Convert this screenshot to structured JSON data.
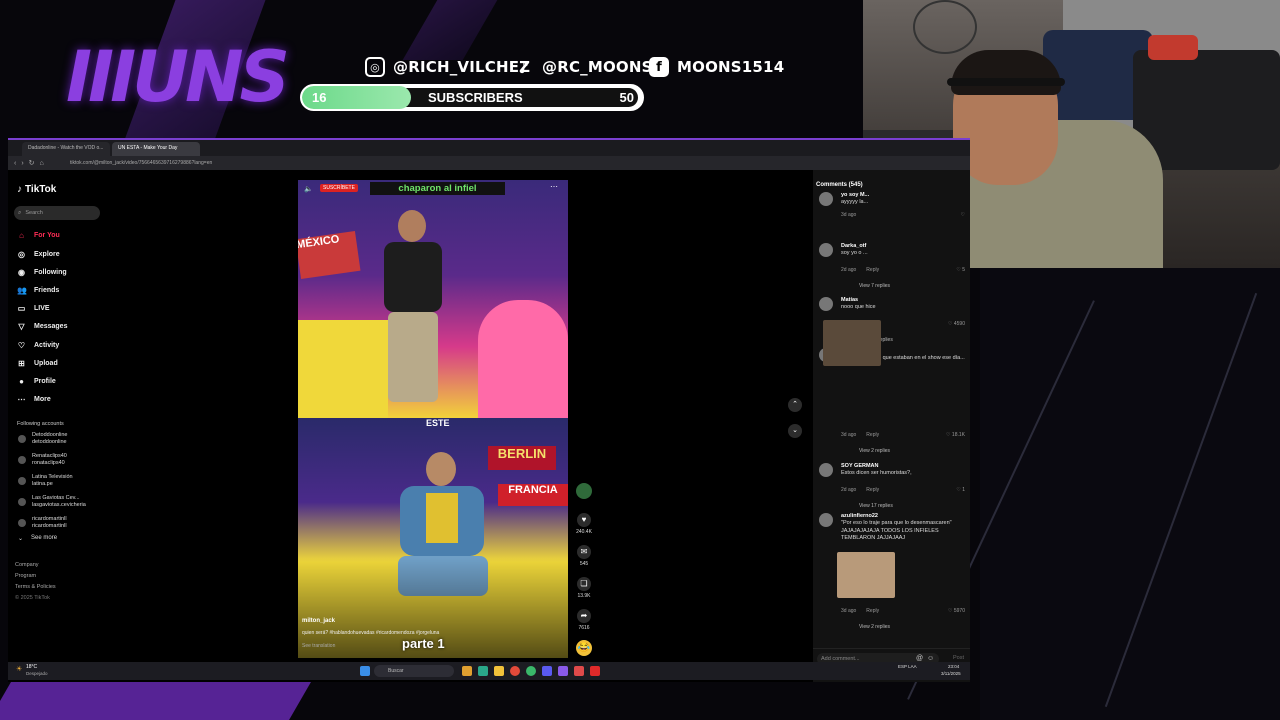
{
  "overlay": {
    "logo": "IIIUNS",
    "socials": [
      {
        "icon": "instagram-icon",
        "handle": "@RICH_VILCHEZ"
      },
      {
        "icon": "tiktok-icon",
        "handle": "@RC_MOONS"
      },
      {
        "icon": "facebook-icon",
        "handle": "MOONS1514"
      }
    ],
    "subscribers": {
      "current": "16",
      "label": "SUBSCRIBERS",
      "goal": "50",
      "progress": 0.32
    }
  },
  "browser": {
    "tabs": [
      "Dadadonline - Watch the VOD o...",
      "UN ESTA - Make Your Day"
    ],
    "url": "tiktok.com/@milton_jack/video/7566465639716279886?lang=en"
  },
  "tiktok": {
    "logo": "TikTok",
    "search_placeholder": "Search",
    "nav": [
      {
        "label": "For You",
        "icon": "home-icon",
        "active": true
      },
      {
        "label": "Explore",
        "icon": "compass-icon"
      },
      {
        "label": "Following",
        "icon": "following-icon"
      },
      {
        "label": "Friends",
        "icon": "friends-icon"
      },
      {
        "label": "LIVE",
        "icon": "live-icon"
      },
      {
        "label": "Messages",
        "icon": "messages-icon"
      },
      {
        "label": "Activity",
        "icon": "activity-icon"
      },
      {
        "label": "Upload",
        "icon": "upload-icon"
      },
      {
        "label": "Profile",
        "icon": "profile-icon"
      },
      {
        "label": "More",
        "icon": "more-icon"
      }
    ],
    "following_header": "Following accounts",
    "following": [
      {
        "name": "Detoddoonline",
        "handle": "detoddoonline"
      },
      {
        "name": "Renataclips40",
        "handle": "ronataclips40"
      },
      {
        "name": "Latina Televisión",
        "handle": "latina.pe"
      },
      {
        "name": "Las Gaviotas Cev...",
        "handle": "lasgaviotas.cevicheria"
      },
      {
        "name": "ricardomartinll",
        "handle": "ricardomartinll"
      }
    ],
    "see_more": "See more",
    "footer": [
      "Company",
      "Program",
      "Terms & Policies",
      "© 2025 TikTok"
    ],
    "video": {
      "banner": "chaparon al infiel",
      "subscribe_badge": "SUSCRÍBETE",
      "label_este": "ESTE",
      "sign_berlin": "BERLIN",
      "sign_francia": "FRANCIA",
      "sign_mexico": "MÉXICO",
      "part": "parte 1",
      "author": "milton_jack",
      "caption": "quien será? #hablandohuevadas #ricardomendoza #jorgeluna",
      "see_translation": "See translation"
    },
    "actions": [
      {
        "icon": "heart-icon",
        "count": "240.4K"
      },
      {
        "icon": "comment-icon",
        "count": "545"
      },
      {
        "icon": "bookmark-icon",
        "count": "13.9K"
      },
      {
        "icon": "share-icon",
        "count": "7616"
      }
    ],
    "comments_title": "Comments (545)",
    "comments": [
      {
        "name": "yo soy M...",
        "text": "ayyyyy la...",
        "date": "3d ago",
        "reply": "",
        "likes": ""
      },
      {
        "name": "Darka_otf",
        "text": "soy yo o ...",
        "date": "2d ago",
        "reply": "Reply",
        "likes": "5",
        "replies": "View 7 replies"
      },
      {
        "name": "Matías",
        "text": "nooo que hice",
        "date": "3d ago",
        "reply": "Reply",
        "likes": "4590",
        "replies": "View 22 replies"
      },
      {
        "name": "Joeyy",
        "text": "todos los Matías que estaban en el show ese día...",
        "date": "3d ago",
        "reply": "Reply",
        "likes": "18.1K",
        "replies": "View 2 replies"
      },
      {
        "name": "SOY GERMAN",
        "text": "Estos dicen ser humoristas?,",
        "date": "2d ago",
        "reply": "Reply",
        "likes": "1",
        "replies": "View 17 replies"
      },
      {
        "name": "azulinfierno22",
        "text": "\"Por eso lo traje para que lo desenmascaren\" JAJAJAJAJAJA TODOS LOS INFIELES TEMBLARON JAJJAJAAJ",
        "date": "3d ago",
        "reply": "Reply",
        "likes": "5970",
        "replies": "View 2 replies"
      }
    ],
    "add_comment": "Add comment...",
    "post": "Post"
  },
  "taskbar": {
    "weather": "18°C",
    "weather_sub": "Despejado",
    "search": "Buscar",
    "lang": "ESP LAA",
    "time": "23:04",
    "date": "3/11/2025"
  },
  "colors": {
    "accent": "#8b3fe0",
    "tiktok_red": "#fe2c55",
    "progress": "#6cd98a"
  }
}
